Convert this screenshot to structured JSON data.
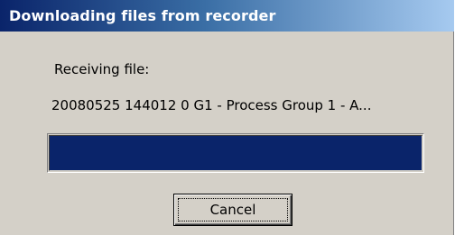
{
  "window": {
    "title": "Downloading files from recorder"
  },
  "content": {
    "status_label": "Receiving file:",
    "file_name": "20080525 144012 0 G1 - Process Group 1 - A..."
  },
  "progress": {
    "fraction": 1.0,
    "fill_color": "#0a246a"
  },
  "buttons": {
    "cancel_label": "Cancel"
  },
  "colors": {
    "dialog_background": "#d4d0c8",
    "titlebar_start": "#0a246a",
    "titlebar_end": "#a6caf0"
  }
}
